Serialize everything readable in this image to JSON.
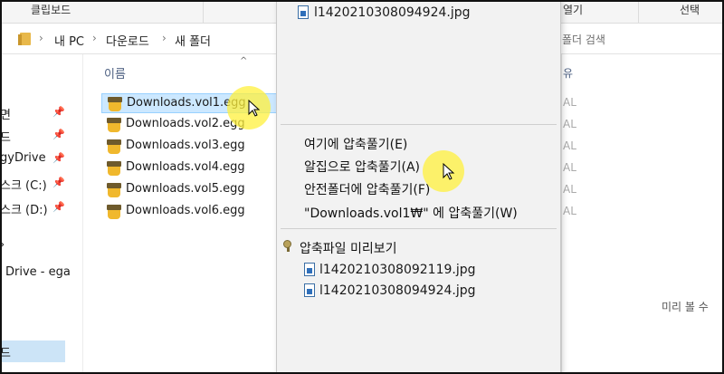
{
  "ribbon": {
    "clipboard_label": "클립보드",
    "open_label": "열기",
    "select_label": "선택"
  },
  "address": {
    "crumbs": [
      "내 PC",
      "다운로드",
      "새 폴더"
    ],
    "search_placeholder": "폴더 검색"
  },
  "nav": {
    "items": [
      {
        "label": "면"
      },
      {
        "label": "드"
      },
      {
        "label": "gyDrive"
      },
      {
        "label": "스크 (C:)"
      },
      {
        "label": "스크 (D:)"
      },
      {
        "label": "Drive - ega"
      },
      {
        "label": "드"
      }
    ]
  },
  "list": {
    "column_name": "이름",
    "column_type": "유",
    "files": [
      {
        "name": "Downloads.vol1.egg",
        "type": "AL"
      },
      {
        "name": "Downloads.vol2.egg",
        "type": "AL"
      },
      {
        "name": "Downloads.vol3.egg",
        "type": "AL"
      },
      {
        "name": "Downloads.vol4.egg",
        "type": "AL"
      },
      {
        "name": "Downloads.vol5.egg",
        "type": "AL"
      },
      {
        "name": "Downloads.vol6.egg",
        "type": "AL"
      }
    ]
  },
  "preview": {
    "text": "미리 볼 수"
  },
  "context_menu": {
    "top_file": "l1420210308094924.jpg",
    "extract_here": "여기에 압축풀기(E)",
    "extract_alzip": "알집으로 압축풀기(A)",
    "extract_safe": "안전폴더에 압축풀기(F)",
    "extract_to_folder": "\"Downloads.vol1₩\" 에 압축풀기(W)",
    "preview_title": "압축파일 미리보기",
    "preview_files": [
      "l1420210308092119.jpg",
      "l1420210308094924.jpg"
    ]
  }
}
